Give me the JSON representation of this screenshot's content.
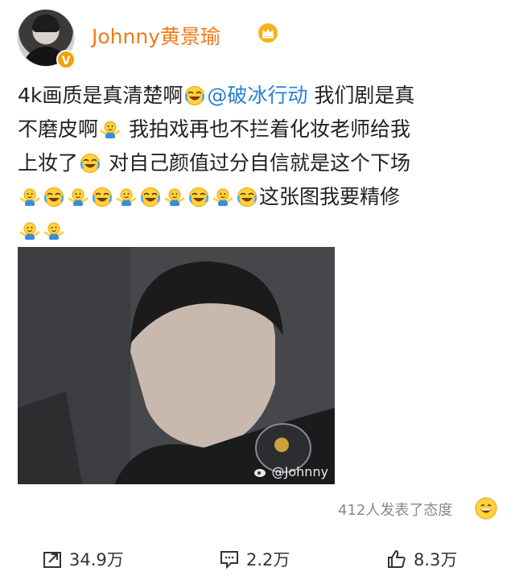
{
  "user": {
    "name": "Johnny黄景瑜",
    "verified_badge": "V"
  },
  "post": {
    "line1_text": "4k画质是真清楚啊",
    "mention": "@破冰行动",
    "line1_tail": " 我们剧是真",
    "line2_text": "不磨皮啊",
    "line2_tail": " 我拍戏再也不拦着化妆老师给我",
    "line3_text": "上妆了",
    "line3_tail": "  对自己颜值过分自信就是这个下场",
    "line4_tail": "这张图我要精修"
  },
  "image": {
    "watermark": "@Johnny"
  },
  "reactions": {
    "attitude_text": "412人发表了态度"
  },
  "actions": {
    "share_count": "34.9万",
    "comment_count": "2.2万",
    "like_count": "8.3万"
  },
  "colors": {
    "username": "#f07a1a",
    "mention": "#2a7fd4",
    "badge": "#f0a20b"
  },
  "icons": [
    "crown-icon",
    "laugh-cry-emoji",
    "shrug-emoji",
    "grin-emoji",
    "share-icon",
    "comment-icon",
    "like-icon",
    "weibo-logo-icon"
  ]
}
